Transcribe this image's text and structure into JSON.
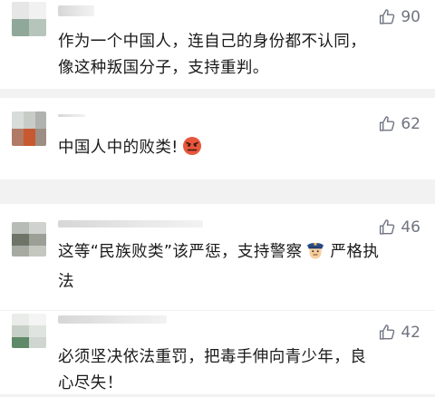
{
  "comments": [
    {
      "lines": [
        "作为一个中国人，连自己的身份都不认同，",
        "像这种叛国分子，支持重判。"
      ],
      "likes": "90",
      "icon": "thumbs-up-icon"
    },
    {
      "text": "中国人中的败类!",
      "emoji": "angry-face-icon",
      "likes": "62",
      "icon": "thumbs-up-icon"
    },
    {
      "line1_pre": "这等“民族败类”该严惩，支持警察",
      "emoji": "police-officer-icon",
      "line1_post": "严格执",
      "line2": "法",
      "likes": "46",
      "icon": "thumbs-up-icon"
    },
    {
      "lines": [
        "必须坚决依法重罚，把毒手伸向青少年，良",
        "心尽失！"
      ],
      "likes": "42",
      "icon": "thumbs-up-icon"
    }
  ],
  "colors": {
    "like": "#6f7480",
    "text": "#1a1a1a",
    "separator": "#f2f2f2",
    "emoji_angry": "#e8563b"
  }
}
